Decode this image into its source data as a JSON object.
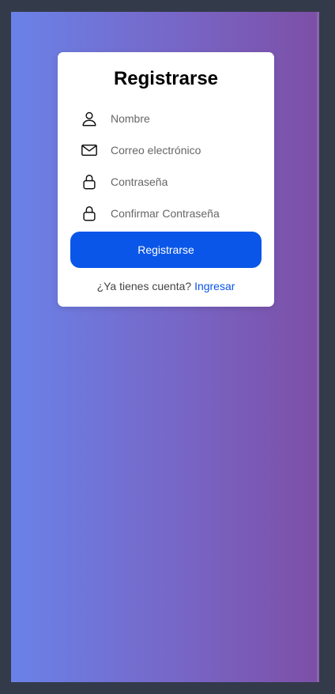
{
  "form": {
    "title": "Registrarse",
    "fields": [
      {
        "icon": "user-icon",
        "placeholder": "Nombre"
      },
      {
        "icon": "mail-icon",
        "placeholder": "Correo electrónico"
      },
      {
        "icon": "lock-icon",
        "placeholder": "Contraseña"
      },
      {
        "icon": "lock-icon",
        "placeholder": "Confirmar Contraseña"
      }
    ],
    "submit_label": "Registrarse",
    "footer_text": "¿Ya tienes cuenta?",
    "login_link": "Ingresar"
  },
  "colors": {
    "primary": "#0a56e8",
    "gradient_start": "#6a82e8",
    "gradient_end": "#7d4fa6",
    "frame": "#333a4a"
  }
}
